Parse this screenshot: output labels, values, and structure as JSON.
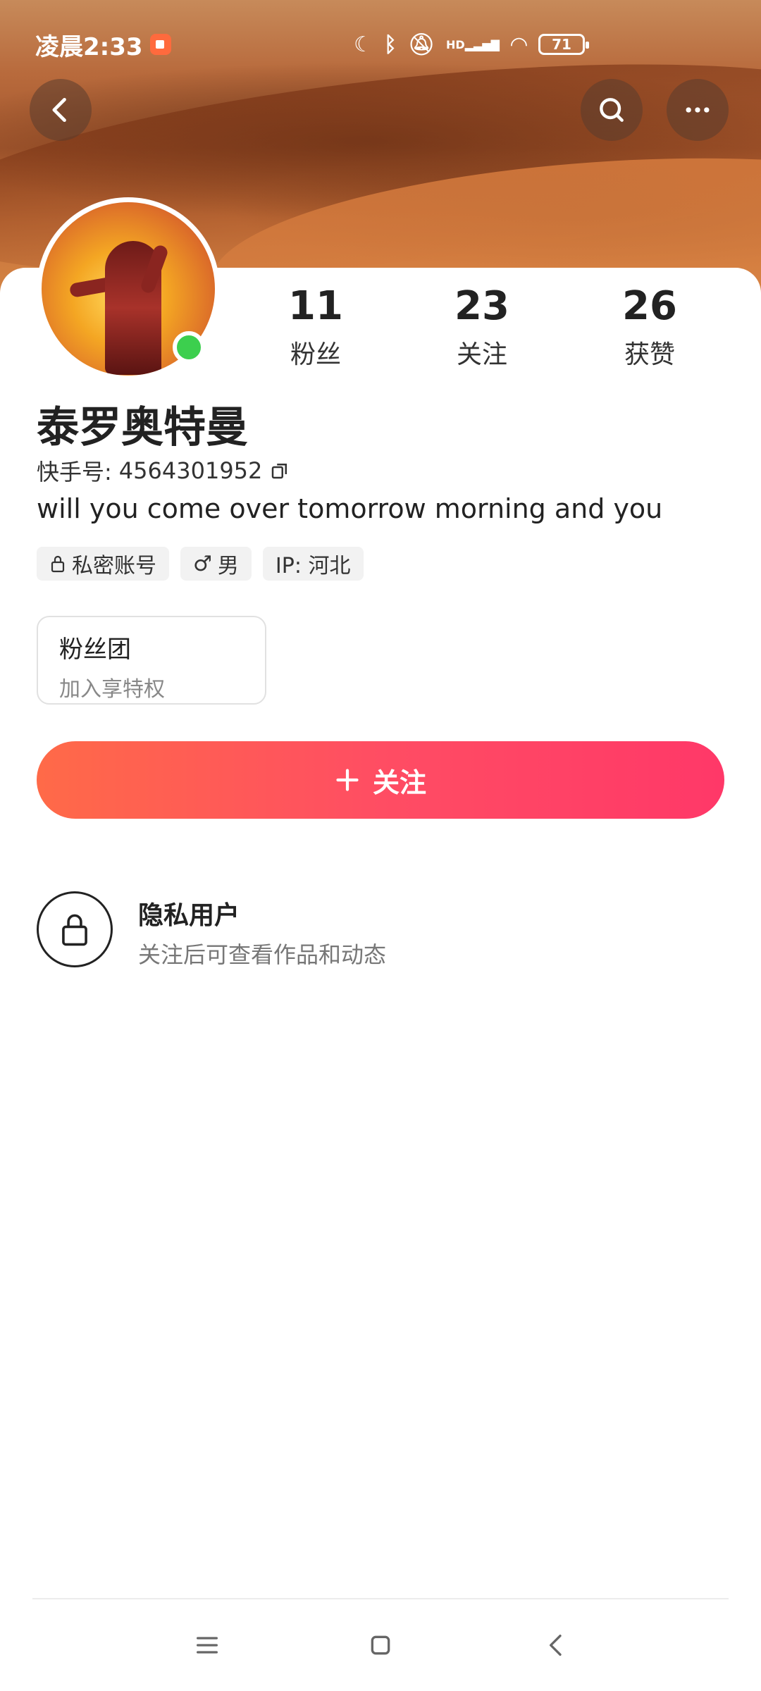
{
  "status_bar": {
    "time": "凌晨2:33",
    "network_label": "HD",
    "battery": "71"
  },
  "profile": {
    "name": "泰罗奥特曼",
    "id_label": "快手号:",
    "id_value": "4564301952",
    "bio": "will you come over tomorrow morning and you",
    "tags": {
      "private": "私密账号",
      "gender": "男",
      "ip": "IP: 河北"
    }
  },
  "stats": [
    {
      "value": "11",
      "label": "粉丝"
    },
    {
      "value": "23",
      "label": "关注"
    },
    {
      "value": "26",
      "label": "获赞"
    }
  ],
  "fan_group": {
    "title": "粉丝团",
    "subtitle": "加入享特权"
  },
  "follow_button": {
    "label": "关注"
  },
  "private_notice": {
    "title": "隐私用户",
    "subtitle": "关注后可查看作品和动态"
  },
  "colors": {
    "follow_gradient_start": "#ff6a48",
    "follow_gradient_end": "#ff3868",
    "online_dot": "#3ccf4e"
  },
  "icons": [
    "back-icon",
    "search-icon",
    "more-icon",
    "lock-icon",
    "copy-icon",
    "male-icon",
    "plus-icon",
    "menu-icon",
    "home-icon",
    "back-nav-icon"
  ]
}
